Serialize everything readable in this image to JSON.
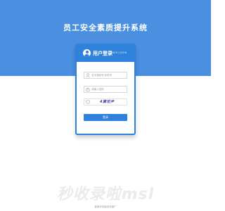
{
  "app": {
    "title": "员工安全素质提升系统"
  },
  "login_panel": {
    "title": "用户登录",
    "subtitle": "USER LOGIN",
    "username": {
      "placeholder": "名字或帐号/手机号"
    },
    "password": {
      "placeholder": "请输入密码"
    },
    "captcha": {
      "value": "",
      "image_text": "4黛坦尹"
    },
    "submit_label": "登录"
  },
  "watermark": "秒收录啦msl",
  "footer": {
    "text": "营销手机版优化推广"
  },
  "colors": {
    "primary": "#2f82dc",
    "band": "#4a8fe0"
  }
}
